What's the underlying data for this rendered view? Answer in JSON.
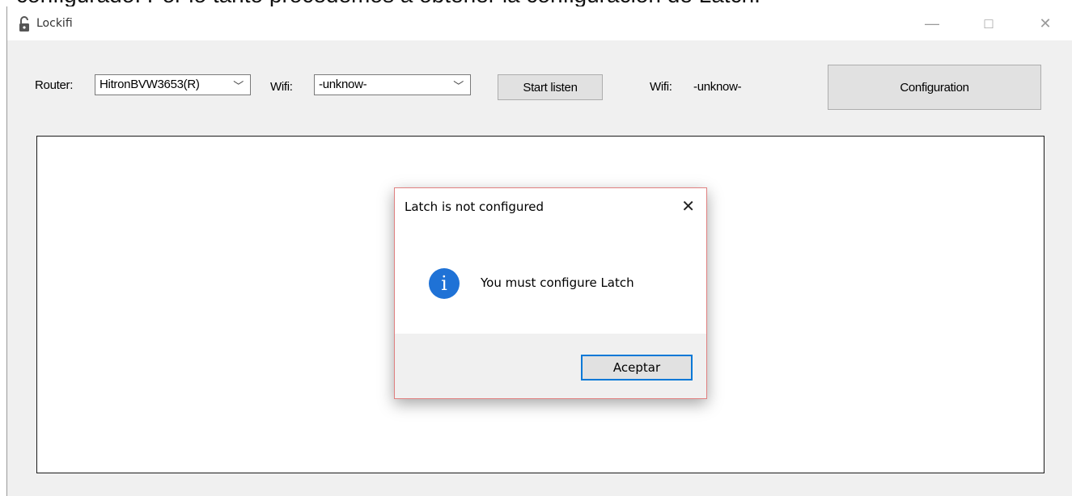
{
  "page_caption": "configurado. Por lo tanto procedemos a obtener la configuración de Latch.",
  "window": {
    "title": "Lockifi",
    "controls": {
      "minimize": "—",
      "maximize": "□",
      "close": "✕"
    }
  },
  "toolbar": {
    "router_label": "Router:",
    "router_value": "HitronBVW3653(R)",
    "wifi_label": "Wifi:",
    "wifi_value": "-unknow-",
    "start_button": "Start listen",
    "wifi_status_label": "Wifi:",
    "wifi_status_value": "-unknow-",
    "config_button": "Configuration"
  },
  "dialog": {
    "title": "Latch is not configured",
    "close": "✕",
    "icon_glyph": "i",
    "message": "You must configure Latch",
    "ok_button": "Aceptar"
  },
  "icons": {
    "app": "lock-icon",
    "dropdown": "chevron-down-icon",
    "info": "info-icon"
  },
  "colors": {
    "info_icon": "#1f72d6",
    "dialog_border": "#e08080",
    "default_button_border": "#0078d7"
  }
}
